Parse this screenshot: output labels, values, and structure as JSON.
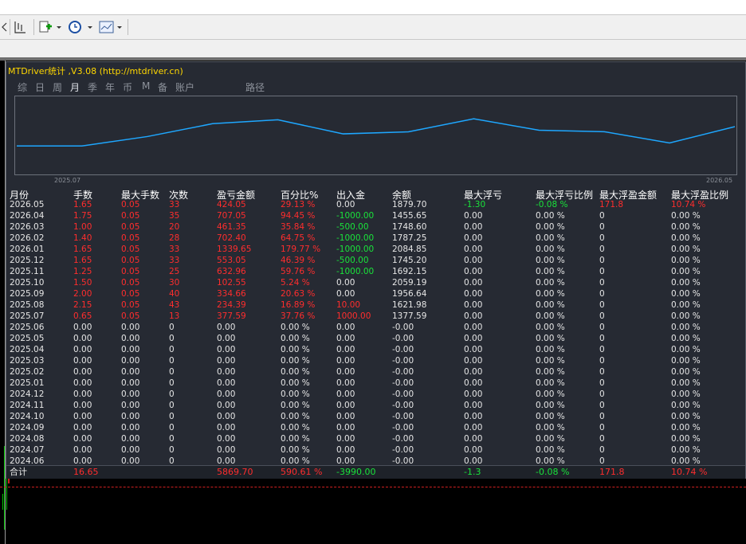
{
  "window": {
    "title": "MTDriver统计 ,V3.08 (http://mtdriver.cn)"
  },
  "toolbar": {
    "icons": [
      "zoom-out-icon",
      "crosshair-icon",
      "add-indicator-icon",
      "clock-icon",
      "chart-template-icon"
    ]
  },
  "tabs": [
    {
      "label": "综",
      "active": false
    },
    {
      "label": "日",
      "active": false
    },
    {
      "label": "周",
      "active": false
    },
    {
      "label": "月",
      "active": true
    },
    {
      "label": "季",
      "active": false
    },
    {
      "label": "年",
      "active": false
    },
    {
      "label": "币",
      "active": false
    },
    {
      "label": "M",
      "active": false
    },
    {
      "label": "备",
      "active": false
    },
    {
      "label": "账户",
      "active": false
    },
    {
      "label": "路径",
      "active": false
    }
  ],
  "chart_data": {
    "type": "line",
    "x": [
      "2025.06",
      "2025.07",
      "2025.08",
      "2025.09",
      "2025.10",
      "2025.11",
      "2025.12",
      "2026.01",
      "2026.02",
      "2026.03",
      "2026.04",
      "2026.05"
    ],
    "values": [
      1377.59,
      1377.59,
      1621.98,
      1956.64,
      2059.19,
      1692.15,
      1745.2,
      2084.85,
      1787.25,
      1748.6,
      1455.65,
      1879.7
    ],
    "start_label": "2025.07",
    "end_label": "2026.05",
    "line_color": "#1ea7ff"
  },
  "table": {
    "columns": [
      "月份",
      "手数",
      "最大手数",
      "次数",
      "盈亏金额",
      "百分比%",
      "出入金",
      "余额",
      "最大浮亏",
      "最大浮亏比例",
      "最大浮盈金额",
      "最大浮盈比例"
    ],
    "rows": [
      [
        "2026.05",
        "1.65",
        "0.05",
        "33",
        "424.05",
        "29.13 %",
        "0.00",
        "1879.70",
        "-1.30",
        "-0.08 %",
        "171.8",
        "10.74 %"
      ],
      [
        "2026.04",
        "1.75",
        "0.05",
        "35",
        "707.05",
        "94.45 %",
        "-1000.00",
        "1455.65",
        "0.00",
        "0.00 %",
        "0",
        "0.00 %"
      ],
      [
        "2026.03",
        "1.00",
        "0.05",
        "20",
        "461.35",
        "35.84 %",
        "-500.00",
        "1748.60",
        "0.00",
        "0.00 %",
        "0",
        "0.00 %"
      ],
      [
        "2026.02",
        "1.40",
        "0.05",
        "28",
        "702.40",
        "64.75 %",
        "-1000.00",
        "1787.25",
        "0.00",
        "0.00 %",
        "0",
        "0.00 %"
      ],
      [
        "2026.01",
        "1.65",
        "0.05",
        "33",
        "1339.65",
        "179.77 %",
        "-1000.00",
        "2084.85",
        "0.00",
        "0.00 %",
        "0",
        "0.00 %"
      ],
      [
        "2025.12",
        "1.65",
        "0.05",
        "33",
        "553.05",
        "46.39 %",
        "-500.00",
        "1745.20",
        "0.00",
        "0.00 %",
        "0",
        "0.00 %"
      ],
      [
        "2025.11",
        "1.25",
        "0.05",
        "25",
        "632.96",
        "59.76 %",
        "-1000.00",
        "1692.15",
        "0.00",
        "0.00 %",
        "0",
        "0.00 %"
      ],
      [
        "2025.10",
        "1.50",
        "0.05",
        "30",
        "102.55",
        "5.24 %",
        "0.00",
        "2059.19",
        "0.00",
        "0.00 %",
        "0",
        "0.00 %"
      ],
      [
        "2025.09",
        "2.00",
        "0.05",
        "40",
        "334.66",
        "20.63 %",
        "0.00",
        "1956.64",
        "0.00",
        "0.00 %",
        "0",
        "0.00 %"
      ],
      [
        "2025.08",
        "2.15",
        "0.05",
        "43",
        "234.39",
        "16.89 %",
        "10.00",
        "1621.98",
        "0.00",
        "0.00 %",
        "0",
        "0.00 %"
      ],
      [
        "2025.07",
        "0.65",
        "0.05",
        "13",
        "377.59",
        "37.76 %",
        "1000.00",
        "1377.59",
        "0.00",
        "0.00 %",
        "0",
        "0.00 %"
      ],
      [
        "2025.06",
        "0.00",
        "0.00",
        "0",
        "0.00",
        "0.00 %",
        "0.00",
        "-0.00",
        "0.00",
        "0.00 %",
        "0",
        "0.00 %"
      ],
      [
        "2025.05",
        "0.00",
        "0.00",
        "0",
        "0.00",
        "0.00 %",
        "0.00",
        "-0.00",
        "0.00",
        "0.00 %",
        "0",
        "0.00 %"
      ],
      [
        "2025.04",
        "0.00",
        "0.00",
        "0",
        "0.00",
        "0.00 %",
        "0.00",
        "-0.00",
        "0.00",
        "0.00 %",
        "0",
        "0.00 %"
      ],
      [
        "2025.03",
        "0.00",
        "0.00",
        "0",
        "0.00",
        "0.00 %",
        "0.00",
        "-0.00",
        "0.00",
        "0.00 %",
        "0",
        "0.00 %"
      ],
      [
        "2025.02",
        "0.00",
        "0.00",
        "0",
        "0.00",
        "0.00 %",
        "0.00",
        "-0.00",
        "0.00",
        "0.00 %",
        "0",
        "0.00 %"
      ],
      [
        "2025.01",
        "0.00",
        "0.00",
        "0",
        "0.00",
        "0.00 %",
        "0.00",
        "-0.00",
        "0.00",
        "0.00 %",
        "0",
        "0.00 %"
      ],
      [
        "2024.12",
        "0.00",
        "0.00",
        "0",
        "0.00",
        "0.00 %",
        "0.00",
        "-0.00",
        "0.00",
        "0.00 %",
        "0",
        "0.00 %"
      ],
      [
        "2024.11",
        "0.00",
        "0.00",
        "0",
        "0.00",
        "0.00 %",
        "0.00",
        "-0.00",
        "0.00",
        "0.00 %",
        "0",
        "0.00 %"
      ],
      [
        "2024.10",
        "0.00",
        "0.00",
        "0",
        "0.00",
        "0.00 %",
        "0.00",
        "-0.00",
        "0.00",
        "0.00 %",
        "0",
        "0.00 %"
      ],
      [
        "2024.09",
        "0.00",
        "0.00",
        "0",
        "0.00",
        "0.00 %",
        "0.00",
        "-0.00",
        "0.00",
        "0.00 %",
        "0",
        "0.00 %"
      ],
      [
        "2024.08",
        "0.00",
        "0.00",
        "0",
        "0.00",
        "0.00 %",
        "0.00",
        "-0.00",
        "0.00",
        "0.00 %",
        "0",
        "0.00 %"
      ],
      [
        "2024.07",
        "0.00",
        "0.00",
        "0",
        "0.00",
        "0.00 %",
        "0.00",
        "-0.00",
        "0.00",
        "0.00 %",
        "0",
        "0.00 %"
      ],
      [
        "2024.06",
        "0.00",
        "0.00",
        "0",
        "0.00",
        "0.00 %",
        "0.00",
        "-0.00",
        "0.00",
        "0.00 %",
        "0",
        "0.00 %"
      ]
    ],
    "total": [
      "合计",
      "16.65",
      "",
      "",
      "5869.70",
      "590.61 %",
      "-3990.00",
      "",
      "-1.3",
      "-0.08 %",
      "171.8",
      "10.74 %"
    ]
  },
  "colors": {
    "panel_bg": "#262a33",
    "text_white": "#e6e6e6",
    "text_red": "#ff2d2d",
    "text_green": "#19e33a",
    "title_yellow": "#ffd700"
  }
}
